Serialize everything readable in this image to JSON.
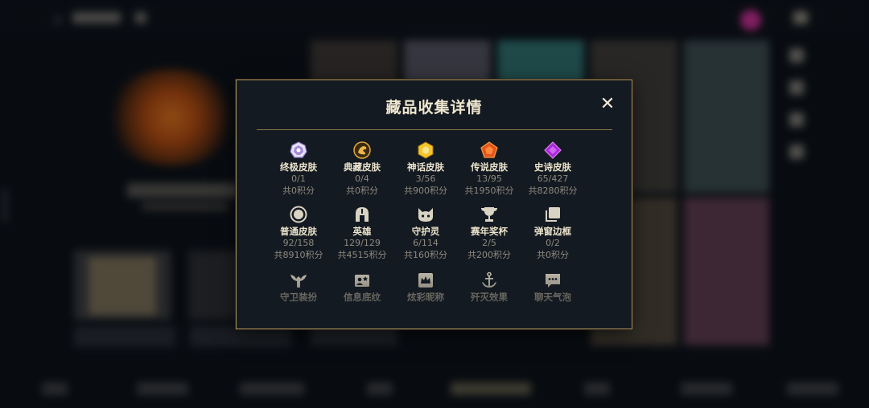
{
  "modal": {
    "title": "藏品收集详情",
    "close_label": "✕",
    "items_row1": [
      {
        "name": "终极皮肤",
        "count": "0/1",
        "points": "共0积分",
        "icon": "ultimate-gem-icon"
      },
      {
        "name": "典藏皮肤",
        "count": "0/4",
        "points": "共0积分",
        "icon": "collection-dragon-icon"
      },
      {
        "name": "神话皮肤",
        "count": "3/56",
        "points": "共900积分",
        "icon": "mythic-gem-icon"
      },
      {
        "name": "传说皮肤",
        "count": "13/95",
        "points": "共1950积分",
        "icon": "legendary-gem-icon"
      },
      {
        "name": "史诗皮肤",
        "count": "65/427",
        "points": "共8280积分",
        "icon": "epic-gem-icon"
      }
    ],
    "items_row2": [
      {
        "name": "普通皮肤",
        "count": "92/158",
        "points": "共8910积分",
        "icon": "normal-skin-icon"
      },
      {
        "name": "英雄",
        "count": "129/129",
        "points": "共4515积分",
        "icon": "helmet-icon"
      },
      {
        "name": "守护灵",
        "count": "6/114",
        "points": "共160积分",
        "icon": "guardian-cat-icon"
      },
      {
        "name": "赛年奖杯",
        "count": "2/5",
        "points": "共200积分",
        "icon": "trophy-icon"
      },
      {
        "name": "弹窗边框",
        "count": "0/2",
        "points": "共0积分",
        "icon": "frame-icon"
      }
    ],
    "items_row3": [
      {
        "name": "守卫装扮",
        "icon": "ward-icon"
      },
      {
        "name": "信息底纹",
        "icon": "info-card-icon"
      },
      {
        "name": "炫彩昵称",
        "icon": "crown-icon"
      },
      {
        "name": "歼灭效果",
        "icon": "anchor-icon"
      },
      {
        "name": "聊天气泡",
        "icon": "chat-bubble-icon"
      }
    ]
  },
  "colors": {
    "accent_gold": "#a98d5b",
    "title_text": "#efe6cf",
    "muted_text": "#8f8a80",
    "modal_bg": "#141a21"
  }
}
